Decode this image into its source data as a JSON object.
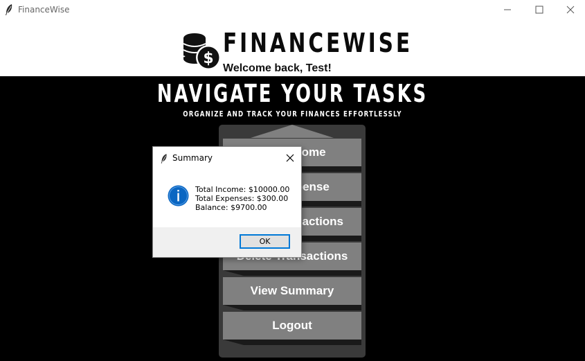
{
  "window": {
    "title": "FinanceWise",
    "app_icon": "feather-icon",
    "controls": [
      "minimize-icon",
      "maximize-icon",
      "close-icon"
    ]
  },
  "header": {
    "logo_icon": "coins-dollar-icon",
    "brand": "FINANCEWISE",
    "welcome": "Welcome back, Test!"
  },
  "main": {
    "title": "NAVIGATE YOUR TASKS",
    "subtitle": "ORGANIZE AND TRACK YOUR FINANCES EFFORTLESSLY",
    "menu": [
      {
        "label": "Add Income"
      },
      {
        "label": "Add Expense"
      },
      {
        "label": "View Transactions"
      },
      {
        "label": "Delete Transactions"
      },
      {
        "label": "View Summary"
      },
      {
        "label": "Logout"
      }
    ]
  },
  "dialog": {
    "title": "Summary",
    "icon": "info-icon",
    "lines": [
      "Total Income: $10000.00",
      "Total Expenses: $300.00",
      "Balance: $9700.00"
    ],
    "ok_label": "OK"
  },
  "colors": {
    "background": "#000000",
    "menu_button": "#808080",
    "menu_panel": "#3a3a3a",
    "info_icon": "#0a66c2",
    "ok_border": "#0078d7"
  }
}
